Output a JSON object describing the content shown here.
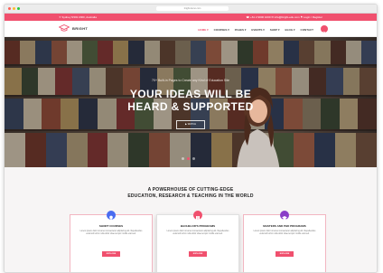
{
  "browser": {
    "url": "bright.demo.com"
  },
  "topbar": {
    "address": "✦ Sydney NSW 2000, Australia",
    "contact": "☎ +61 2 9000 1000   ✉ info@bright-edu.com   ⚑ Login / Register"
  },
  "nav": {
    "logo_text": "BRIGHT",
    "items": [
      "HOME ▾",
      "COURSES ▾",
      "PAGES ▾",
      "EVENTS ▾",
      "SHOP ▾",
      "BLOG ▾",
      "CONTACT"
    ]
  },
  "hero": {
    "subtitle": "70+ Built-in Pages to Create any Kind of Education Site",
    "title_line1": "YOUR IDEAS WILL BE",
    "title_line2": "HEARD & SUPPORTED",
    "button": "▶ WATCH"
  },
  "section": {
    "title_line1": "A POWERHOUSE OF CUTTING-EDGE",
    "title_line2": "EDUCATION, RESEARCH & TEACHING IN THE WORLD",
    "cards": [
      {
        "title": "SHORT COURSES",
        "text": "Lorem ipsum dolor sit amet consectetur adipiscing elit. Repellendus euismod tortor nulla dolor vitae tempor mollis erat sed.",
        "button": "EXPLORE",
        "icon_color": "#4a6cf0"
      },
      {
        "title": "BACHELOR'S PROGRAMS",
        "text": "Lorem ipsum dolor sit amet consectetur adipiscing elit. Repellendus euismod tortor nulla dolor vitae tempor mollis erat sed.",
        "button": "EXPLORE",
        "icon_color": "#f0506e"
      },
      {
        "title": "MASTERS AND PHD PROGRAMS",
        "text": "Lorem ipsum dolor sit amet consectetur adipiscing elit. Repellendus euismod tortor nulla dolor vitae tempor mollis erat sed.",
        "button": "EXPLORE",
        "icon_color": "#8a3ec8"
      }
    ]
  },
  "colors": {
    "accent": "#f0506e"
  }
}
